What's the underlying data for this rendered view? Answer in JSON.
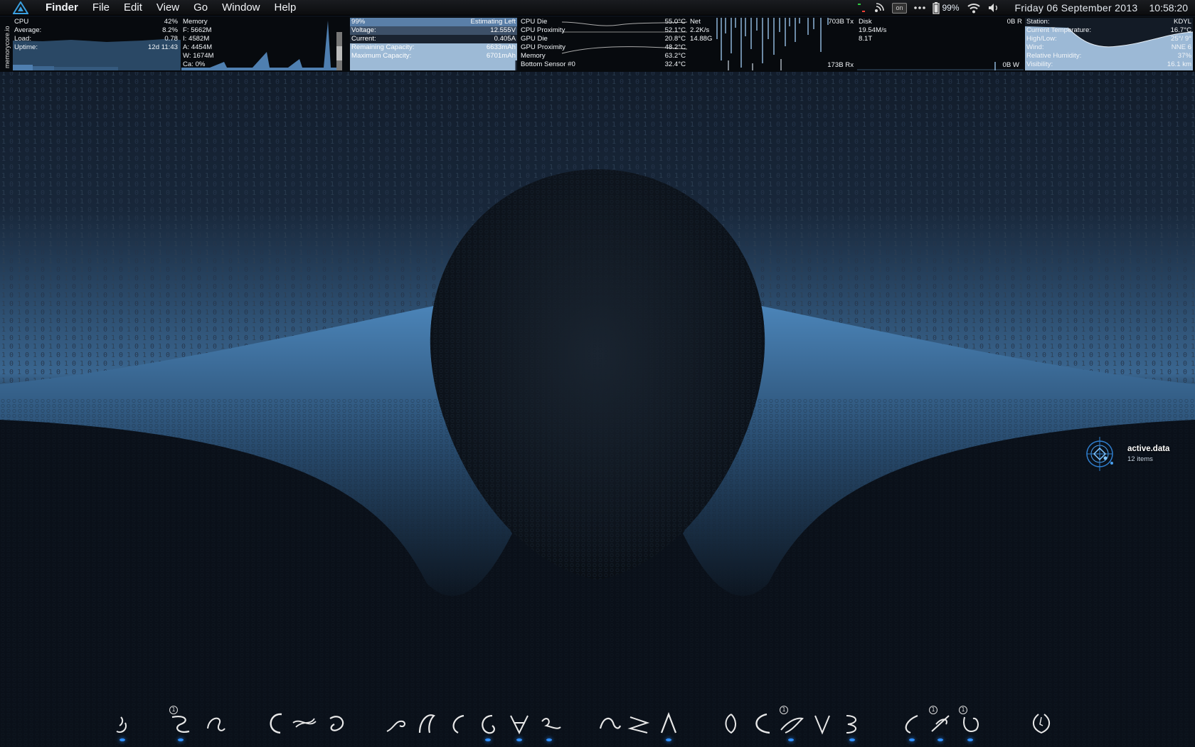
{
  "menubar": {
    "items": [
      {
        "label": "Finder",
        "app": true
      },
      {
        "label": "File"
      },
      {
        "label": "Edit"
      },
      {
        "label": "View"
      },
      {
        "label": "Go"
      },
      {
        "label": "Window"
      },
      {
        "label": "Help"
      }
    ],
    "status": {
      "on_badge": "on",
      "battery": "99%",
      "date": "Friday 06 September 2013",
      "time": "10:58:20"
    }
  },
  "stats": {
    "cpu": {
      "vertical_label": "memorycore.io",
      "rows": [
        {
          "label": "CPU",
          "value": "42%"
        },
        {
          "label": "Average:",
          "value": "8.2%"
        },
        {
          "label": "Load:",
          "value": "0.78"
        },
        {
          "label": "Uptime:",
          "value": "12d 11:43"
        }
      ]
    },
    "memory": {
      "rows": [
        {
          "label": "Memory"
        },
        {
          "label": "F: 5662M"
        },
        {
          "label": "I: 4582M"
        },
        {
          "label": "A: 4454M"
        },
        {
          "label": "W: 1674M"
        },
        {
          "label": "Ca: 0%"
        }
      ]
    },
    "battery": {
      "rows": [
        {
          "label": "99%",
          "value": "Estimating Left"
        },
        {
          "label": "Voltage:",
          "value": "12.555V"
        },
        {
          "label": "Current:",
          "value": "0.405A"
        },
        {
          "label": "Remaining Capacity:",
          "value": "6633mAh"
        },
        {
          "label": "Maximum Capacity:",
          "value": "6701mAh"
        }
      ],
      "charge_fraction": 0.99
    },
    "temps": {
      "rows": [
        {
          "label": "CPU Die",
          "value": "55.0°C"
        },
        {
          "label": "CPU Proximity",
          "value": "52.1°C"
        },
        {
          "label": "GPU Die",
          "value": "20.8°C"
        },
        {
          "label": "GPU Proximity",
          "value": "48.2°C"
        },
        {
          "label": "Memory",
          "value": "63.2°C"
        },
        {
          "label": "Bottom Sensor #0",
          "value": "32.4°C"
        }
      ]
    },
    "net": {
      "rows": [
        {
          "label": "Net"
        },
        {
          "label": "2.2K/s"
        },
        {
          "label": "14.88G"
        }
      ],
      "tx": "703B Tx",
      "rx": "173B Rx"
    },
    "disk": {
      "rows": [
        {
          "label": "Disk"
        },
        {
          "label": "19.54M/s"
        },
        {
          "label": "8.1T"
        }
      ],
      "read": "0B R",
      "write": "0B W"
    },
    "weather": {
      "rows": [
        {
          "label": "Station:",
          "value": "KDYL"
        },
        {
          "label": "Current Temperature:",
          "value": "16.7°C"
        },
        {
          "label": "High/Low:",
          "value": "25°/ 9°"
        },
        {
          "label": "Wind:",
          "value": "NNE 6"
        },
        {
          "label": "Relative Humidity:",
          "value": "37%"
        },
        {
          "label": "Visibility:",
          "value": "16.1 km"
        }
      ]
    }
  },
  "desktop_icon": {
    "name": "active.data",
    "subtitle": "12 items"
  },
  "dock": {
    "badges": [
      "1",
      "1",
      "1",
      "1"
    ]
  },
  "colors": {
    "accent_blue": "#3f74a6",
    "panel_blue": "#9dbad6",
    "dock_dot": "#2f8fff"
  }
}
